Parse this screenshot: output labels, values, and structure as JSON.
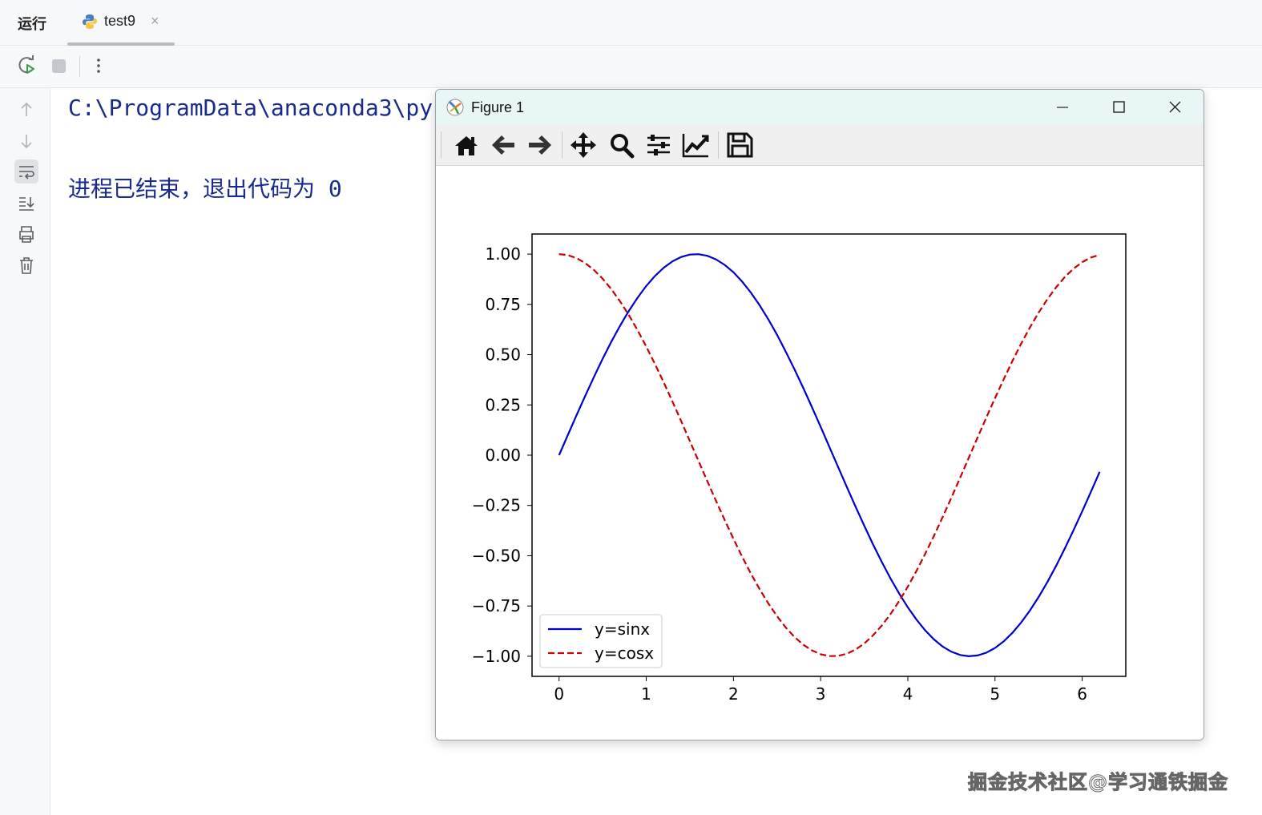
{
  "header": {
    "run_label": "运行",
    "tab": {
      "label": "test9",
      "close": "×",
      "icon": "python-icon"
    }
  },
  "toolbar": {
    "rerun_icon": "rerun-icon",
    "stop_icon": "stop-icon",
    "more_icon": "more-vertical-icon"
  },
  "gutter": {
    "items": [
      "arrow-up-icon",
      "arrow-down-icon",
      "soft-wrap-icon",
      "scroll-to-end-icon",
      "print-icon",
      "trash-icon"
    ]
  },
  "console": {
    "line1": "C:\\ProgramData\\anaconda3\\py",
    "line2": "进程已结束，退出代码为 0"
  },
  "figure_window": {
    "title": "Figure 1",
    "icon": "matplotlib-icon",
    "controls": [
      "minimize-icon",
      "maximize-icon",
      "close-icon"
    ],
    "toolbar": [
      "home-icon",
      "back-arrow-icon",
      "forward-arrow-icon",
      "pan-icon",
      "zoom-icon",
      "configure-subplots-icon",
      "edit-axis-icon",
      "save-icon"
    ]
  },
  "chart_data": {
    "type": "line",
    "title": "",
    "xlabel": "",
    "ylabel": "",
    "xlim": [
      -0.31,
      6.5
    ],
    "ylim": [
      -1.1,
      1.1
    ],
    "xticks": [
      "0",
      "1",
      "2",
      "3",
      "4",
      "5",
      "6"
    ],
    "yticks": [
      "1.00",
      "0.75",
      "0.50",
      "0.25",
      "0.00",
      "−0.25",
      "−0.50",
      "−0.75",
      "−1.00"
    ],
    "grid": false,
    "legend_position": "lower-left",
    "series": [
      {
        "name": "y=sinx",
        "function": "sin",
        "x_start": 0,
        "x_end": 6.2,
        "x_step": 0.1,
        "color": "#0000cc",
        "style": "solid"
      },
      {
        "name": "y=cosx",
        "function": "cos",
        "x_start": 0,
        "x_end": 6.2,
        "x_step": 0.1,
        "color": "#cc0000",
        "style": "dashed"
      }
    ]
  },
  "watermark": "掘金技术社区@学习通铁掘金"
}
